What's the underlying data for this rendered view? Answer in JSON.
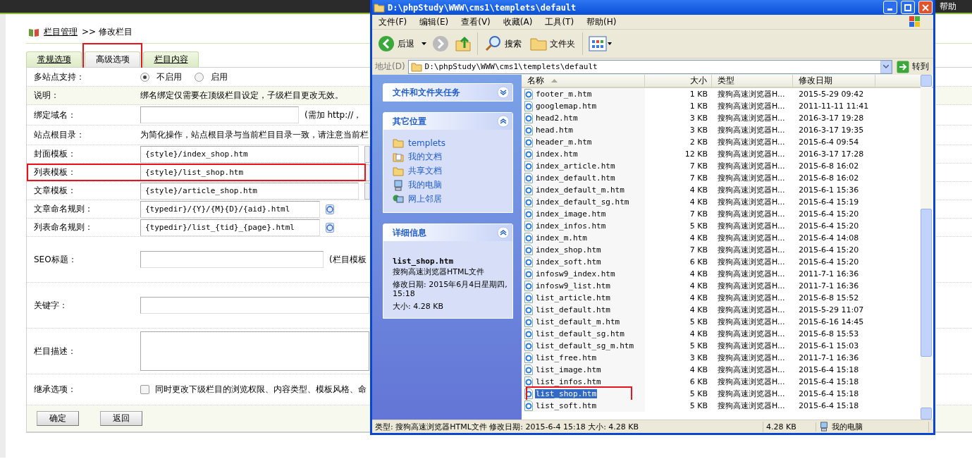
{
  "topbar": {
    "help": "帮助"
  },
  "breadcrumb": {
    "link": "栏目管理",
    "rest": ">> 修改栏目"
  },
  "tabs": [
    {
      "label": "常规选项",
      "selected": false
    },
    {
      "label": "高级选项",
      "selected": true,
      "annotated": true
    },
    {
      "label": "栏目内容",
      "selected": false
    }
  ],
  "form": {
    "rows": [
      {
        "kind": "radio",
        "label": "多站点支持：",
        "options": [
          {
            "label": "不启用",
            "selected": true
          },
          {
            "label": "启用",
            "selected": false
          }
        ]
      },
      {
        "kind": "note",
        "label": "说明：",
        "text": "绑名绑定仅需要在顶级栏目设定，子级栏目更改无效。"
      },
      {
        "kind": "input",
        "label": "绑定域名：",
        "value": "",
        "suffix": "(需加 http://，"
      },
      {
        "kind": "text",
        "label": "站点根目录：",
        "text": "为简化操作，站点根目录与当前栏目目录一致，请注意当前栏"
      },
      {
        "kind": "template",
        "label": "封面模板：",
        "value": "{style}/index_shop.htm"
      },
      {
        "kind": "template",
        "label": "列表模板：",
        "value": "{style}/list_shop.htm",
        "annotated": true
      },
      {
        "kind": "template",
        "label": "文章模板：",
        "value": "{style}/article_shop.htm"
      },
      {
        "kind": "rule",
        "label": "文章命名规则：",
        "value": "{typedir}/{Y}/{M}{D}/{aid}.html"
      },
      {
        "kind": "rule",
        "label": "列表命名规则：",
        "value": "{typedir}/list_{tid}_{page}.html"
      },
      {
        "kind": "tall",
        "label": "SEO标题：",
        "value": "",
        "suffix": "(栏目模板"
      },
      {
        "kind": "tall",
        "label": "关键字：",
        "value": ""
      },
      {
        "kind": "textarea",
        "label": "栏目描述：",
        "value": ""
      },
      {
        "kind": "checkbox",
        "label": "继承选项：",
        "checked": false,
        "text": "同时更改下级栏目的浏览权限、内容类型、模板风格、命"
      }
    ]
  },
  "buttons": [
    "确定",
    "返回"
  ],
  "explorer": {
    "title": "D:\\phpStudy\\WWW\\cms1\\templets\\default",
    "menu": [
      "文件(F)",
      "编辑(E)",
      "查看(V)",
      "收藏(A)",
      "工具(T)",
      "帮助(H)"
    ],
    "toolbar": {
      "back": "后退",
      "search": "搜索",
      "folders": "文件夹"
    },
    "address": {
      "label": "地址(D)",
      "value": "D:\\phpStudy\\WWW\\cms1\\templets\\default",
      "go": "转到"
    },
    "panels": [
      {
        "title": "文件和文件夹任务",
        "expanded": false
      },
      {
        "title": "其它位置",
        "expanded": true,
        "links": [
          {
            "kind": "folder",
            "label": "templets"
          },
          {
            "kind": "documents",
            "label": "我的文档"
          },
          {
            "kind": "folder",
            "label": "共享文档"
          },
          {
            "kind": "computer",
            "label": "我的电脑"
          },
          {
            "kind": "network",
            "label": "网上邻居"
          }
        ]
      },
      {
        "title": "详细信息",
        "expanded": true,
        "details": {
          "name": "list_shop.htm",
          "type": "搜狗高速浏览器HTML文件",
          "modified": "修改日期: 2015年6月4日星期四, 15:18",
          "size": "大小: 4.28 KB"
        }
      }
    ],
    "columns": [
      "名称",
      "大小",
      "类型",
      "修改日期"
    ],
    "files": [
      {
        "name": "footer_m.htm",
        "size": "1 KB",
        "type": "搜狗高速浏览器H...",
        "date": "2015-5-29 09:42",
        "selected": false
      },
      {
        "name": "googlemap.htm",
        "size": "1 KB",
        "type": "搜狗高速浏览器H...",
        "date": "2011-11-11 11:41",
        "selected": false
      },
      {
        "name": "head2.htm",
        "size": "3 KB",
        "type": "搜狗高速浏览器H...",
        "date": "2016-3-17 19:28",
        "selected": false
      },
      {
        "name": "head.htm",
        "size": "3 KB",
        "type": "搜狗高速浏览器H...",
        "date": "2016-3-17 19:35",
        "selected": false
      },
      {
        "name": "header_m.htm",
        "size": "2 KB",
        "type": "搜狗高速浏览器H...",
        "date": "2015-6-4 09:54",
        "selected": false
      },
      {
        "name": "index.htm",
        "size": "12 KB",
        "type": "搜狗高速浏览器H...",
        "date": "2016-3-17 17:28",
        "selected": false
      },
      {
        "name": "index_article.htm",
        "size": "7 KB",
        "type": "搜狗高速浏览器H...",
        "date": "2015-6-8 16:02",
        "selected": false
      },
      {
        "name": "index_default.htm",
        "size": "7 KB",
        "type": "搜狗高速浏览器H...",
        "date": "2015-6-8 16:02",
        "selected": false
      },
      {
        "name": "index_default_m.htm",
        "size": "4 KB",
        "type": "搜狗高速浏览器H...",
        "date": "2015-6-1 15:36",
        "selected": false
      },
      {
        "name": "index_default_sg.htm",
        "size": "4 KB",
        "type": "搜狗高速浏览器H...",
        "date": "2015-6-4 15:19",
        "selected": false
      },
      {
        "name": "index_image.htm",
        "size": "7 KB",
        "type": "搜狗高速浏览器H...",
        "date": "2015-6-4 15:20",
        "selected": false
      },
      {
        "name": "index_infos.htm",
        "size": "5 KB",
        "type": "搜狗高速浏览器H...",
        "date": "2015-6-4 15:20",
        "selected": false
      },
      {
        "name": "index_m.htm",
        "size": "4 KB",
        "type": "搜狗高速浏览器H...",
        "date": "2015-6-4 14:08",
        "selected": false
      },
      {
        "name": "index_shop.htm",
        "size": "7 KB",
        "type": "搜狗高速浏览器H...",
        "date": "2015-6-4 15:20",
        "selected": false
      },
      {
        "name": "index_soft.htm",
        "size": "6 KB",
        "type": "搜狗高速浏览器H...",
        "date": "2015-6-4 15:20",
        "selected": false
      },
      {
        "name": "infosw9_index.htm",
        "size": "4 KB",
        "type": "搜狗高速浏览器H...",
        "date": "2011-7-1 16:36",
        "selected": false
      },
      {
        "name": "infosw9_list.htm",
        "size": "4 KB",
        "type": "搜狗高速浏览器H...",
        "date": "2011-7-1 16:36",
        "selected": false
      },
      {
        "name": "list_article.htm",
        "size": "4 KB",
        "type": "搜狗高速浏览器H...",
        "date": "2015-6-8 15:52",
        "selected": false
      },
      {
        "name": "list_default.htm",
        "size": "4 KB",
        "type": "搜狗高速浏览器H...",
        "date": "2015-5-29 11:07",
        "selected": false
      },
      {
        "name": "list_default_m.htm",
        "size": "5 KB",
        "type": "搜狗高速浏览器H...",
        "date": "2015-6-16 14:45",
        "selected": false
      },
      {
        "name": "list_default_sg.htm",
        "size": "4 KB",
        "type": "搜狗高速浏览器H...",
        "date": "2015-6-8 15:53",
        "selected": false
      },
      {
        "name": "list_default_sg_m.htm",
        "size": "5 KB",
        "type": "搜狗高速浏览器H...",
        "date": "2015-6-1 15:03",
        "selected": false
      },
      {
        "name": "list_free.htm",
        "size": "3 KB",
        "type": "搜狗高速浏览器H...",
        "date": "2011-7-1 16:36",
        "selected": false
      },
      {
        "name": "list_image.htm",
        "size": "4 KB",
        "type": "搜狗高速浏览器H...",
        "date": "2015-6-4 15:18",
        "selected": false
      },
      {
        "name": "list_infos.htm",
        "size": "6 KB",
        "type": "搜狗高速浏览器H...",
        "date": "2015-6-4 15:18",
        "selected": false
      },
      {
        "name": "list_shop.htm",
        "size": "5 KB",
        "type": "搜狗高速浏览器H...",
        "date": "2015-6-4 15:18",
        "selected": true,
        "annotated": true
      },
      {
        "name": "list_soft.htm",
        "size": "5 KB",
        "type": "搜狗高速浏览器H...",
        "date": "2015-6-4 15:18",
        "selected": false
      }
    ],
    "status": {
      "info": "类型: 搜狗高速浏览器HTML文件 修改日期: 2015-6-4 15:18 大小: 4.28 KB",
      "size": "4.28 KB",
      "zone": "我的电脑"
    }
  }
}
